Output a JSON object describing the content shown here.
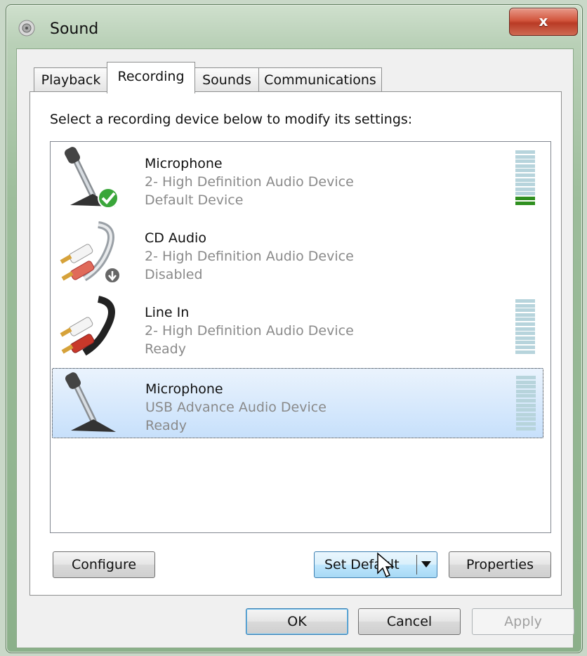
{
  "window": {
    "title": "Sound",
    "close_label": "x"
  },
  "tabs": [
    {
      "label": "Playback"
    },
    {
      "label": "Recording"
    },
    {
      "label": "Sounds"
    },
    {
      "label": "Communications"
    }
  ],
  "instruction": "Select a recording device below to modify its settings:",
  "devices": [
    {
      "name": "Microphone",
      "description": "2- High Definition Audio Device",
      "status": "Default Device",
      "icon": "microphone-icon",
      "badge": "check-badge-icon",
      "meter_level": 0.1
    },
    {
      "name": "CD Audio",
      "description": "2- High Definition Audio Device",
      "status": "Disabled",
      "icon": "rca-cable-white-icon",
      "badge": "disabled-badge-icon"
    },
    {
      "name": "Line In",
      "description": "2- High Definition Audio Device",
      "status": "Ready",
      "icon": "rca-cable-black-icon",
      "meter_level": 0
    },
    {
      "name": "Microphone",
      "description": "USB Advance Audio Device",
      "status": "Ready",
      "icon": "microphone-icon",
      "meter_level": 0,
      "selected": true
    }
  ],
  "buttons": {
    "configure": "Configure",
    "set_default": "Set Default",
    "properties": "Properties",
    "ok": "OK",
    "cancel": "Cancel",
    "apply": "Apply"
  },
  "colors": {
    "meter_on": "#2f8f1f",
    "meter_off": "#b7d4dc",
    "selection": "#c7e0fb"
  }
}
